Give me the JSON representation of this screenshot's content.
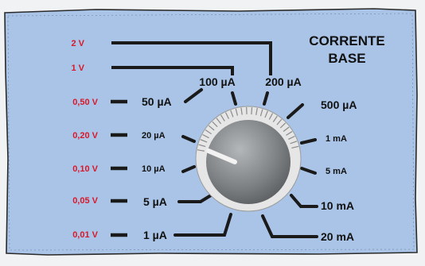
{
  "panel": {
    "title_line1": "CORRENTE",
    "title_line2": "BASE",
    "background": "#a9c4e6",
    "line_color": "#1a1a1a",
    "voltage_color": "#d7192b",
    "text_color": "#111111"
  },
  "voltages": [
    "2 V",
    "1 V",
    "0,50 V",
    "0,20 V",
    "0,10 V",
    "0,05 V",
    "0,01 V"
  ],
  "currents_left": [
    "50 µA",
    "20 µA",
    "10 µA",
    "5 µA",
    "1 µA"
  ],
  "currents_top": [
    "100 µA",
    "200 µA"
  ],
  "currents_right": [
    "500 µA",
    "1 mA",
    "5 mA",
    "10 mA",
    "20 mA"
  ],
  "knob": {
    "icon": "rotary-selector-knob-icon",
    "face_color": "#8a8d90",
    "skirt_color": "#e6e6e6"
  }
}
